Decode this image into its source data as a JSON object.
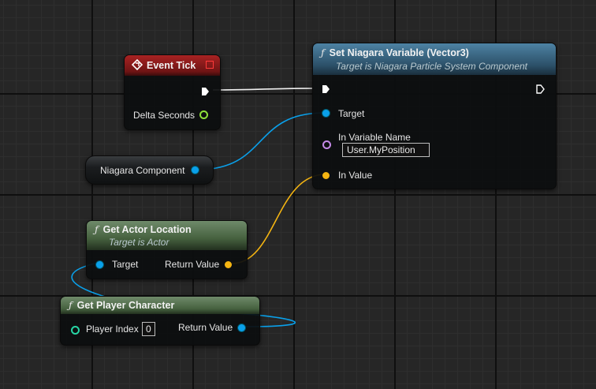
{
  "nodes": {
    "event_tick": {
      "title": "Event Tick",
      "delta_seconds": "Delta Seconds"
    },
    "set_niagara": {
      "title": "Set Niagara Variable (Vector3)",
      "subtitle": "Target is Niagara Particle System Component",
      "target": "Target",
      "in_variable_name": "In Variable Name",
      "in_variable_value": "User.MyPosition",
      "in_value": "In Value"
    },
    "niagara_component": {
      "label": "Niagara Component"
    },
    "get_actor_location": {
      "title": "Get Actor Location",
      "subtitle": "Target is Actor",
      "target": "Target",
      "return_value": "Return Value"
    },
    "get_player_character": {
      "title": "Get Player Character",
      "player_index": "Player Index",
      "player_index_value": "0",
      "return_value": "Return Value"
    }
  },
  "icons": {
    "function": "ƒ",
    "event": "event-diamond-icon"
  },
  "colors": {
    "exec_wire": "#ffffff",
    "struct_pin": "#0aa0ea",
    "vector_pin": "#f5b512",
    "float_pin": "#8ee03a",
    "int_pin": "#27d5a5",
    "name_pin": "#c58ae8",
    "event_header": "#8a1a1a",
    "function_header": "#3c6a86",
    "pure_header": "#4e6e4a"
  }
}
